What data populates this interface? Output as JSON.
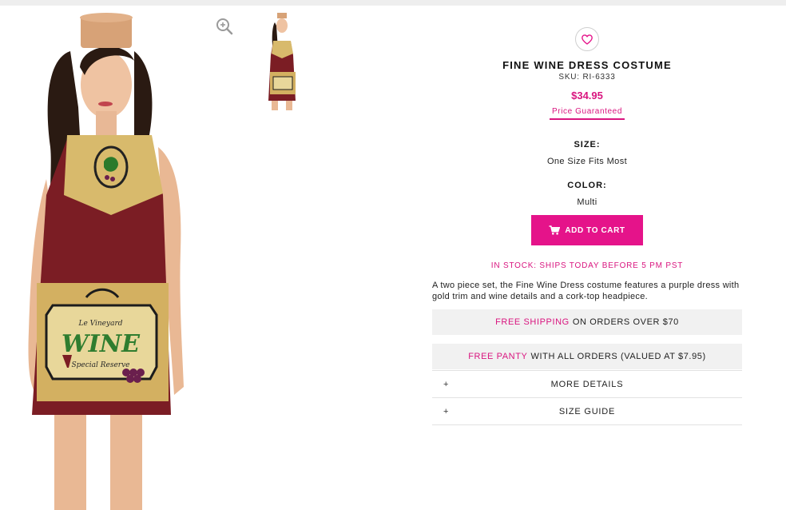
{
  "product": {
    "title": "FINE WINE DRESS COSTUME",
    "sku": "SKU: RI-6333",
    "price": "$34.95",
    "price_guarantee": "Price Guaranteed",
    "size_label": "SIZE:",
    "size_value": "One Size Fits Most",
    "color_label": "COLOR:",
    "color_value": "Multi",
    "add_to_cart": "ADD TO CART",
    "stock_status": "IN STOCK: SHIPS TODAY BEFORE 5 PM PST",
    "description": "A two piece set, the Fine Wine Dress costume features a purple dress with gold trim and wine details and a cork-top headpiece."
  },
  "image_label": {
    "brand": "Le Vineyard",
    "name": "WINE",
    "sub": "Special Reserve"
  },
  "promos": [
    {
      "highlight": "FREE SHIPPING",
      "text": "ON ORDERS OVER $70"
    },
    {
      "highlight": "FREE PANTY",
      "text": "WITH ALL ORDERS (VALUED AT $7.95)"
    }
  ],
  "accordion": [
    {
      "icon": "+",
      "label": "MORE DETAILS"
    },
    {
      "icon": "+",
      "label": "SIZE GUIDE"
    }
  ],
  "icons": {
    "wishlist": "heart-icon",
    "zoom": "zoom-in-icon",
    "cart": "cart-icon"
  },
  "colors": {
    "accent": "#e5138a",
    "price": "#d9157f",
    "promo_bg": "#f1f1f1"
  }
}
